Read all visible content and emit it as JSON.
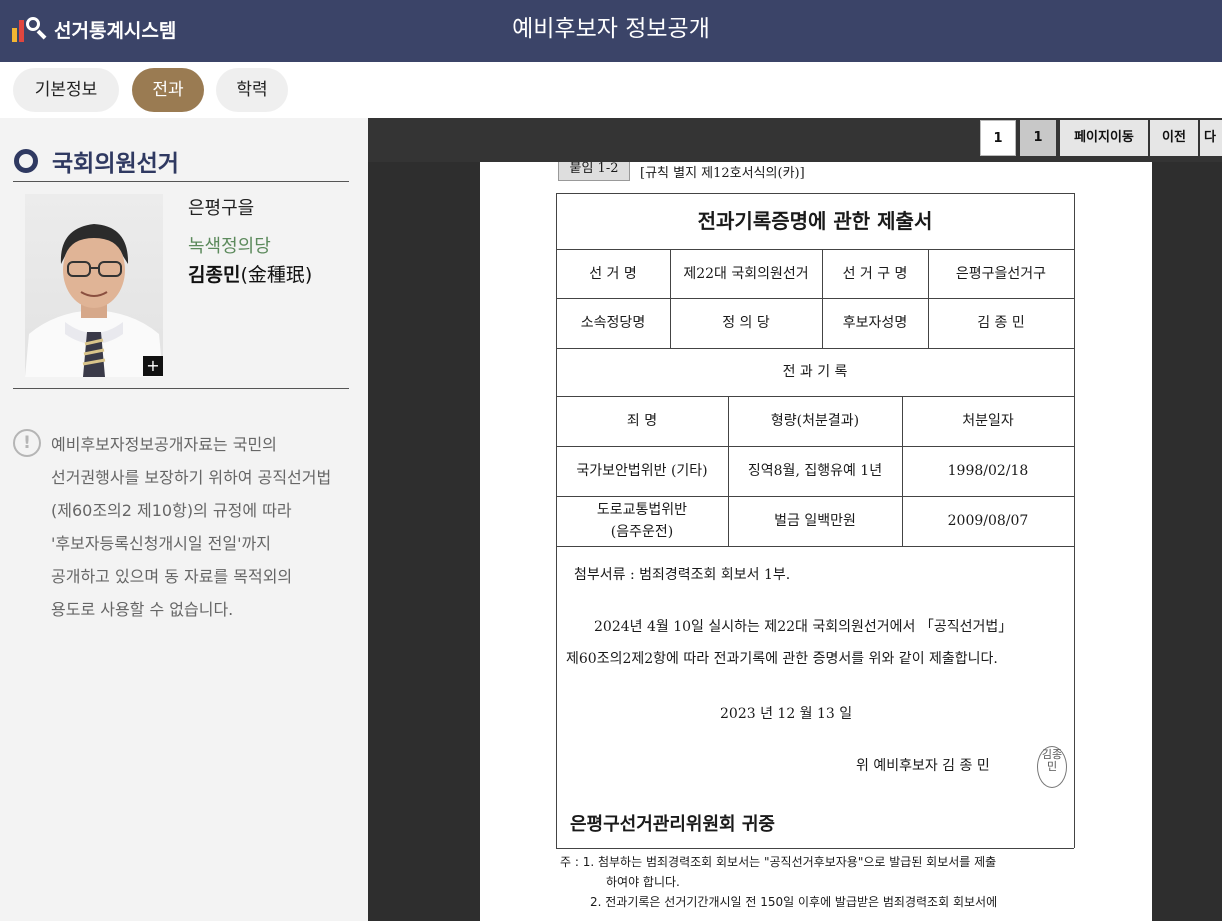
{
  "header": {
    "logo_text": "선거통계시스템",
    "title": "예비후보자 정보공개"
  },
  "tabs": [
    {
      "label": "기본정보",
      "active": false
    },
    {
      "label": "전과",
      "active": true
    },
    {
      "label": "학력",
      "active": false
    }
  ],
  "sidebar": {
    "section_title": "국회의원선거",
    "district": "은평구을",
    "party": "녹색정의당",
    "name": "김종민",
    "name_hanja": "(金種珉)",
    "notice_lines": "예비후보자정보공개자료는 국민의\n선거권행사를 보장하기 위하여 공직선거법\n(제60조의2 제10항)의 규정에 따라\n'후보자등록신청개시일 전일'까지\n공개하고 있으며 동 자료를 목적외의\n용도로 사용할 수 없습니다."
  },
  "viewer": {
    "page_input": "1",
    "total_pages": "1",
    "goto_label": "페이지이동",
    "prev_label": "이전",
    "next_label": "다"
  },
  "document": {
    "tag": "붙임 1-2",
    "form_ref": "[규칙 별지 제12호서식의(카)]",
    "title": "전과기록증명에 관한 제출서",
    "election_label": "선  거  명",
    "election_value": "제22대 국회의원선거",
    "district_label": "선 거 구 명",
    "district_value": "은평구을선거구",
    "party_label": "소속정당명",
    "party_value": "정 의 당",
    "candidate_label": "후보자성명",
    "candidate_value": "김 종 민",
    "record_header": "전  과  기  록",
    "col_crime": "죄    명",
    "col_sentence": "형량(처분결과)",
    "col_date": "처분일자",
    "records": [
      {
        "crime": "국가보안법위반 (기타)",
        "sentence": "징역8월, 집행유예 1년",
        "date": "1998/02/18"
      },
      {
        "crime": "도로교통법위반\n(음주운전)",
        "sentence": "벌금 일백만원",
        "date": "2009/08/07"
      }
    ],
    "attachment": "첨부서류 : 범죄경력조회 회보서 1부.",
    "statement_line1": "2024년 4월 10일 실시하는 제22대 국회의원선거에서 「공직선거법」",
    "statement_line2": "제60조의2제2항에 따라 전과기록에 관한 증명서를 위와 같이 제출합니다.",
    "date_line": "2023 년      12  월     13  일",
    "signer": "위    예비후보자  김 종 민",
    "stamp": "김종민",
    "recipient": "은평구선거관리위원회 귀중",
    "note1": "주 : 1. 첨부하는 범죄경력조회 회보서는 \"공직선거후보자용\"으로 발급된 회보서를 제출",
    "note1b": "하여야 합니다.",
    "note2": "2. 전과기록은 선거기간개시일 전 150일 이후에 발급받은 범죄경력조회 회보서에"
  }
}
